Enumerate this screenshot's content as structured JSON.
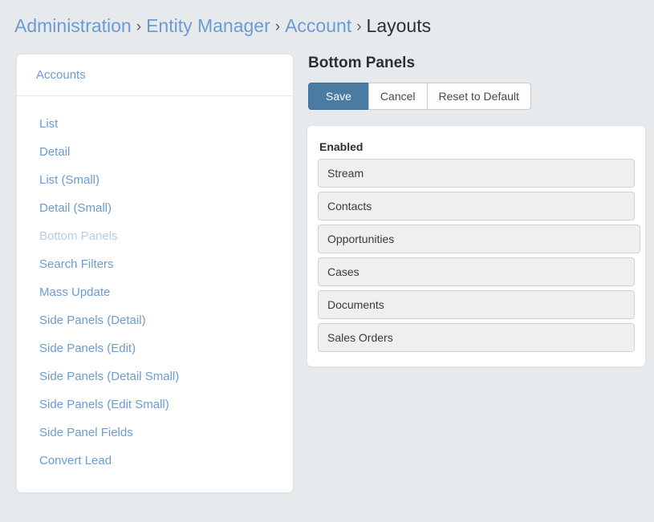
{
  "breadcrumb": {
    "separator": "›",
    "items": [
      {
        "label": "Administration",
        "current": false
      },
      {
        "label": "Entity Manager",
        "current": false
      },
      {
        "label": "Account",
        "current": false
      },
      {
        "label": "Layouts",
        "current": true
      }
    ]
  },
  "sidebar": {
    "header_label": "Accounts",
    "items": [
      {
        "label": "List",
        "active": false
      },
      {
        "label": "Detail",
        "active": false
      },
      {
        "label": "List (Small)",
        "active": false
      },
      {
        "label": "Detail (Small)",
        "active": false
      },
      {
        "label": "Bottom Panels",
        "active": true
      },
      {
        "label": "Search Filters",
        "active": false
      },
      {
        "label": "Mass Update",
        "active": false
      },
      {
        "label": "Side Panels (Detail)",
        "active": false
      },
      {
        "label": "Side Panels (Edit)",
        "active": false
      },
      {
        "label": "Side Panels (Detail Small)",
        "active": false
      },
      {
        "label": "Side Panels (Edit Small)",
        "active": false
      },
      {
        "label": "Side Panel Fields",
        "active": false
      },
      {
        "label": "Convert Lead",
        "active": false
      }
    ]
  },
  "content": {
    "title": "Bottom Panels",
    "buttons": [
      {
        "label": "Save",
        "primary": true
      },
      {
        "label": "Cancel",
        "primary": false
      },
      {
        "label": "Reset to Default",
        "primary": false
      }
    ],
    "panel": {
      "label": "Enabled",
      "items": [
        {
          "label": "Stream",
          "wide": false
        },
        {
          "label": "Contacts",
          "wide": false
        },
        {
          "label": "Opportunities",
          "wide": true
        },
        {
          "label": "Cases",
          "wide": false
        },
        {
          "label": "Documents",
          "wide": false
        },
        {
          "label": "Sales Orders",
          "wide": false
        }
      ]
    }
  },
  "colors": {
    "page_background": "#e7eaed",
    "link_blue": "#6b9bd2",
    "active_link_blue": "#b6cce6",
    "primary_button": "#4a7ba3",
    "card_white": "#ffffff",
    "drop_item_gray": "#efefef",
    "text_dark": "#2f2f2f"
  }
}
